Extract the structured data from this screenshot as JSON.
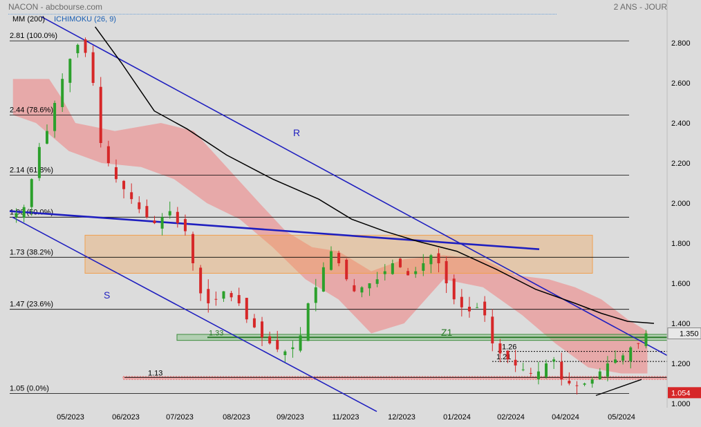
{
  "header": {
    "left": "NACON - abcbourse.com",
    "right": "2 ANS - JOUR",
    "indicator_ma": "MM (200)",
    "indicator_ichimoku": "ICHIMOKU (26, 9)"
  },
  "colors": {
    "background": "#dcdcdc",
    "up_candle": "#2ca02c",
    "down_candle": "#d62728",
    "cloud": "#f08080",
    "trendline": "#1f1fbf",
    "ma": "#000000",
    "zone_orange": "#f0a050",
    "zone_green": "#7fbf7f",
    "price_tag": "#d62728"
  },
  "chart_data": {
    "type": "candlestick",
    "y_axis": {
      "min": 1.0,
      "max": 2.9,
      "position": "right",
      "ticks": [
        "2.800",
        "2.600",
        "2.400",
        "2.200",
        "2.000",
        "1.800",
        "1.600",
        "1.400",
        "1.200",
        "1.000"
      ]
    },
    "x_axis": {
      "tick_labels": [
        "05/2023",
        "06/2023",
        "07/2023",
        "08/2023",
        "09/2023",
        "11/2023",
        "12/2023",
        "01/2024",
        "02/2024",
        "04/2024",
        "05/2024"
      ]
    },
    "fibonacci_levels": [
      {
        "value": 2.81,
        "label": "2.81  (100.0%)"
      },
      {
        "value": 2.44,
        "label": "2.44  (78.6%)"
      },
      {
        "value": 2.14,
        "label": "2.14  (61.8%)"
      },
      {
        "value": 1.93,
        "label": "1.93  (50.0%)"
      },
      {
        "value": 1.73,
        "label": "1.73  (38.2%)"
      },
      {
        "value": 1.47,
        "label": "1.47  (23.6%)"
      },
      {
        "value": 1.05,
        "label": "1.05  (0.0%)"
      }
    ],
    "support_levels": [
      {
        "value": 1.33,
        "label": "1.33"
      },
      {
        "value": 1.26,
        "label": "1.26"
      },
      {
        "value": 1.21,
        "label": "1.21"
      },
      {
        "value": 1.13,
        "label": "1.13"
      }
    ],
    "annotations": [
      "R",
      "S",
      "Z1"
    ],
    "last_price": "1.350",
    "low_tag": "1.054",
    "ma200": [
      [
        0.13,
        2.88
      ],
      [
        0.17,
        2.7
      ],
      [
        0.22,
        2.46
      ],
      [
        0.27,
        2.37
      ],
      [
        0.33,
        2.24
      ],
      [
        0.4,
        2.12
      ],
      [
        0.47,
        2.02
      ],
      [
        0.52,
        1.92
      ],
      [
        0.57,
        1.86
      ],
      [
        0.62,
        1.81
      ],
      [
        0.68,
        1.76
      ],
      [
        0.74,
        1.67
      ],
      [
        0.8,
        1.57
      ],
      [
        0.86,
        1.5
      ],
      [
        0.9,
        1.45
      ],
      [
        0.94,
        1.41
      ],
      [
        0.98,
        1.4
      ]
    ],
    "closes": [
      1.95,
      1.98,
      2.12,
      2.28,
      2.36,
      2.5,
      2.62,
      2.72,
      2.79,
      2.75,
      2.6,
      2.3,
      2.2,
      2.12,
      2.07,
      2.02,
      1.97,
      1.93,
      1.9,
      1.93,
      1.96,
      1.9,
      1.86,
      1.7,
      1.55,
      1.5,
      1.52,
      1.56,
      1.53,
      1.5,
      1.42,
      1.38,
      1.33,
      1.3,
      1.27,
      1.26,
      1.28,
      1.34,
      1.5,
      1.58,
      1.68,
      1.76,
      1.7,
      1.62,
      1.56,
      1.58,
      1.6,
      1.62,
      1.66,
      1.7,
      1.68,
      1.64,
      1.66,
      1.7,
      1.74,
      1.7,
      1.6,
      1.52,
      1.48,
      1.46,
      1.48,
      1.44,
      1.3,
      1.25,
      1.22,
      1.19,
      1.17,
      1.15,
      1.16,
      1.2,
      1.22,
      1.12,
      1.1,
      1.09,
      1.1,
      1.12,
      1.16,
      1.2,
      1.22,
      1.24,
      1.28,
      1.3,
      1.35
    ]
  }
}
